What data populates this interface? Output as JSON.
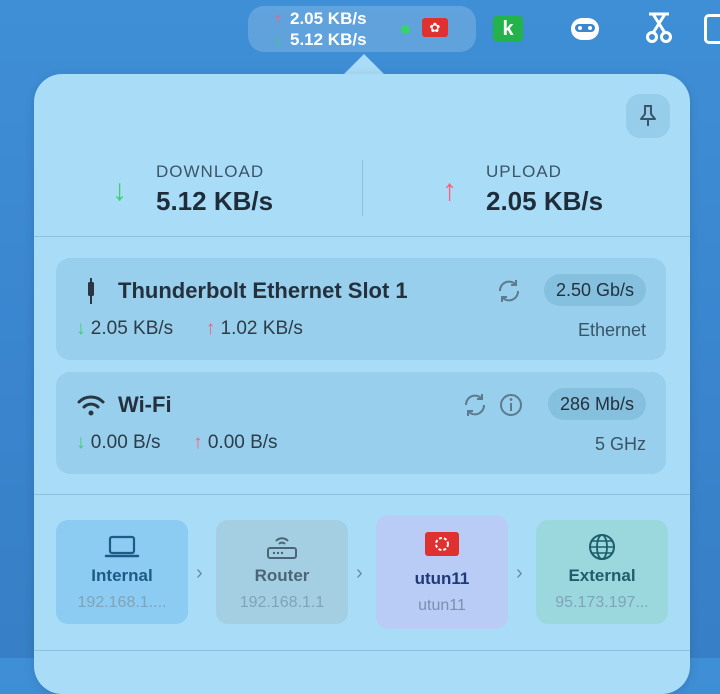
{
  "menubar": {
    "upload_speed": "2.05 KB/s",
    "download_speed": "5.12 KB/s",
    "status_color": "#35d46a",
    "flag_icon": "hong-kong-flag",
    "apps": [
      "k-icon",
      "bot-icon",
      "scissors-icon"
    ]
  },
  "summary": {
    "download_label": "DOWNLOAD",
    "download_value": "5.12 KB/s",
    "upload_label": "UPLOAD",
    "upload_value": "2.05 KB/s"
  },
  "interfaces": [
    {
      "name": "Thunderbolt Ethernet Slot 1",
      "link_speed": "2.50 Gb/s",
      "down": "2.05 KB/s",
      "up": "1.02 KB/s",
      "type": "Ethernet"
    },
    {
      "name": "Wi-Fi",
      "link_speed": "286 Mb/s",
      "down": "0.00 B/s",
      "up": "0.00 B/s",
      "type": "5 GHz"
    }
  ],
  "route": [
    {
      "title": "Internal",
      "sub": "192.168.1...."
    },
    {
      "title": "Router",
      "sub": "192.168.1.1"
    },
    {
      "title": "utun11",
      "sub": "utun11"
    },
    {
      "title": "External",
      "sub": "95.173.197..."
    }
  ],
  "colors": {
    "accent_up": "#ff5a7a",
    "accent_down": "#3ad06b",
    "panel_bg": "#a9dcf6"
  }
}
